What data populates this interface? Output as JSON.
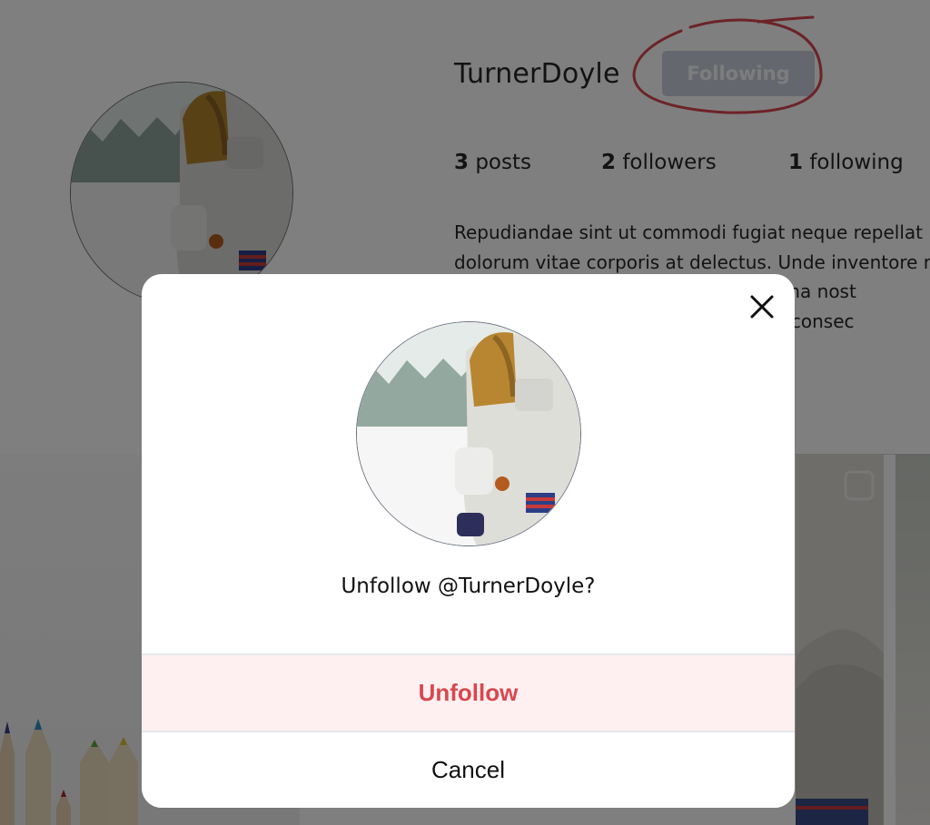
{
  "profile": {
    "username": "TurnerDoyle",
    "follow_button_label": "Following",
    "stats": [
      {
        "count": "3",
        "label": "posts"
      },
      {
        "count": "2",
        "label": "followers"
      },
      {
        "count": "1",
        "label": "following"
      }
    ],
    "bio_lines": [
      "Repudiandae sint ut commodi fugiat neque repellat",
      "dolorum vitae corporis at delectus. Unde inventore r",
      "                                              m minima nost",
      "                                            delectus consec"
    ]
  },
  "modal": {
    "question": "Unfollow @TurnerDoyle?",
    "unfollow_label": "Unfollow",
    "cancel_label": "Cancel",
    "close_icon": "close-icon"
  },
  "colors": {
    "unfollow_text": "#d9474f",
    "unfollow_bg": "#fef0f0",
    "annotation": "#d9474f"
  }
}
